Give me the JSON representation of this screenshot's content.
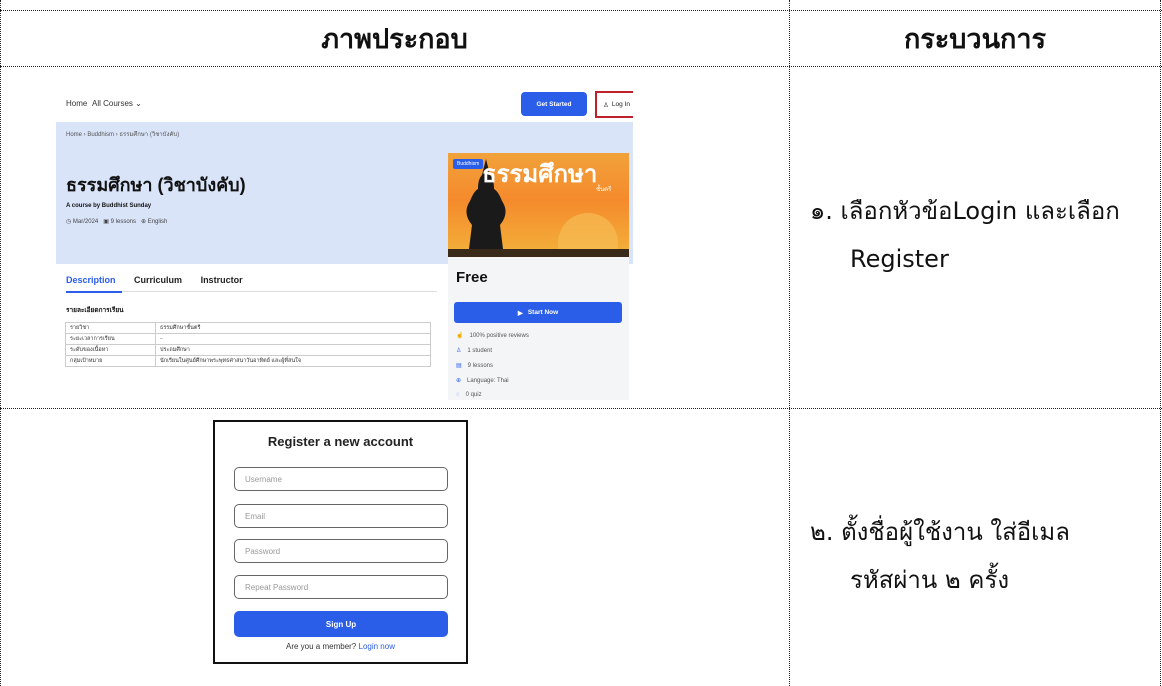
{
  "table": {
    "header_image": "ภาพประกอบ",
    "header_process": "กระบวนการ",
    "rows": [
      {
        "process_line1": "๑. เลือกหัวข้อLogin และเลือก",
        "process_line2": "Register"
      },
      {
        "process_line1": "๒. ตั้งชื่อผู้ใช้งาน ใส่อีเมล",
        "process_line2": "รหัสผ่าน ๒ ครั้ง"
      }
    ]
  },
  "course_page": {
    "nav": {
      "home": "Home",
      "all_courses": "All Courses",
      "get_started": "Get Started",
      "login": "Log In"
    },
    "breadcrumb": "Home  ›  Buddhism  ›  ธรรมศึกษา (วิชาบังคับ)",
    "title": "ธรรมศึกษา (วิชาบังคับ)",
    "byline": "A course by Buddhist Sunday",
    "meta": {
      "date": "Mar/2024",
      "lessons": "9 lessons",
      "language": "English"
    },
    "thumbnail": {
      "badge": "Buddhism",
      "title": "ธรรมศึกษา",
      "subtitle": "ชั้นตรี"
    },
    "price": "Free",
    "start_now": "Start Now",
    "features": [
      "100% positive reviews",
      "1 student",
      "9 lessons",
      "Language: Thai",
      "0 quiz"
    ],
    "tabs": [
      "Description",
      "Curriculum",
      "Instructor"
    ],
    "section_title": "รายละเอียดการเรียน",
    "info_rows": [
      [
        "รายวิชา",
        "ธรรมศึกษาชั้นตรี"
      ],
      [
        "ระยะเวลาการเรียน",
        "–"
      ],
      [
        "ระดับของเนื้อหา",
        "ประถมศึกษา"
      ],
      [
        "กลุ่มเป้าหมาย",
        "นักเรียนในศูนย์ศึกษาพระพุทธศาสนาวันอาทิตย์ และผู้ที่สนใจ"
      ]
    ]
  },
  "register": {
    "title": "Register a new account",
    "username_placeholder": "Username",
    "email_placeholder": "Email",
    "password_placeholder": "Password",
    "repeat_password_placeholder": "Repeat Password",
    "signup": "Sign Up",
    "member_text": "Are you a member?",
    "login_link": "Login now"
  },
  "colors": {
    "accent": "#2a5de8",
    "highlight": "#c0202a",
    "hero_bg": "#d9e4f9"
  }
}
